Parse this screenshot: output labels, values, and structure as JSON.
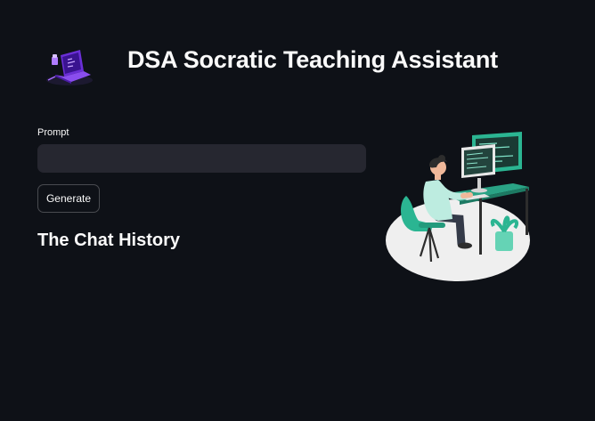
{
  "header": {
    "logo_icon": "laptop-icon",
    "title": "DSA Socratic Teaching Assistant"
  },
  "form": {
    "prompt_label": "Prompt",
    "prompt_value": "",
    "generate_label": "Generate"
  },
  "chat": {
    "heading": "The Chat History"
  },
  "illustration": {
    "icon": "developer-at-desk-illustration"
  },
  "colors": {
    "background": "#0e1117",
    "input_background": "#262730",
    "text": "#fafafa",
    "accent_teal": "#2bb592"
  }
}
